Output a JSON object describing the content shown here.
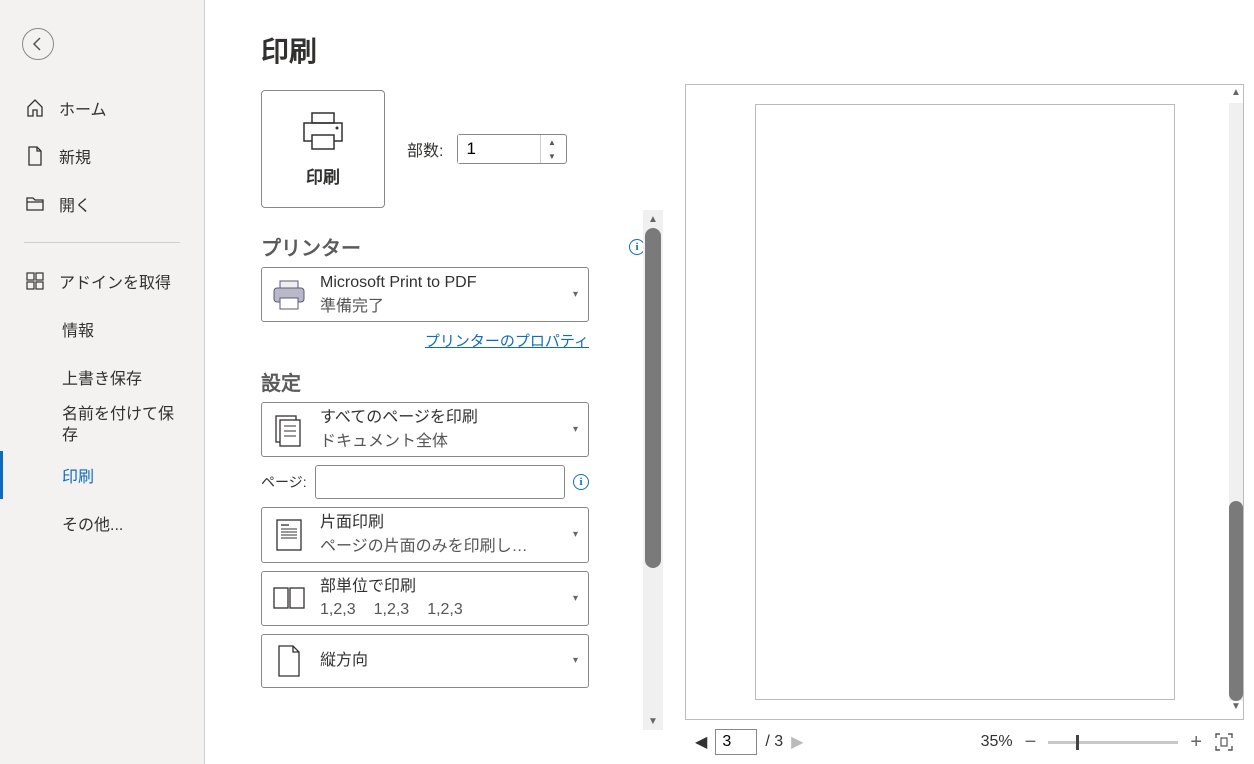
{
  "sidebar": {
    "home": "ホーム",
    "new": "新規",
    "open": "開く",
    "addins": "アドインを取得",
    "info": "情報",
    "save": "上書き保存",
    "saveas": "名前を付けて保存",
    "print": "印刷",
    "other": "その他..."
  },
  "page_title": "印刷",
  "print_button": "印刷",
  "copies": {
    "label": "部数:",
    "value": "1"
  },
  "printer": {
    "section": "プリンター",
    "name": "Microsoft Print to PDF",
    "status": "準備完了",
    "props_link": "プリンターのプロパティ"
  },
  "settings": {
    "section": "設定",
    "pages_label": "ページ:",
    "range": {
      "title": "すべてのページを印刷",
      "sub": "ドキュメント全体"
    },
    "sides": {
      "title": "片面印刷",
      "sub": "ページの片面のみを印刷し…"
    },
    "collate": {
      "title": "部単位で印刷",
      "g1": "1,2,3",
      "g2": "1,2,3",
      "g3": "1,2,3"
    },
    "orient": {
      "title": "縦方向"
    }
  },
  "preview": {
    "current_page": "3",
    "total_pages": "/ 3",
    "zoom": "35%"
  }
}
